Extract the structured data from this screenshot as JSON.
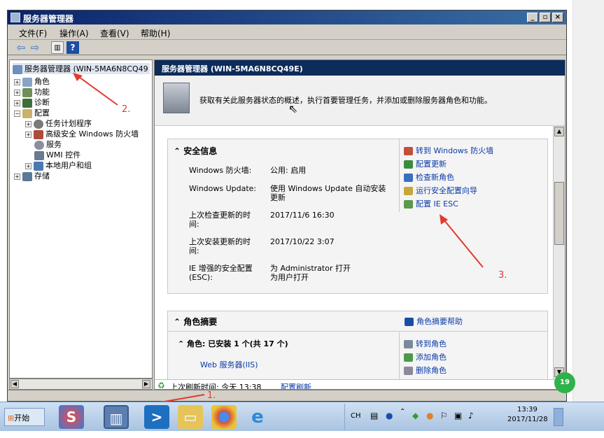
{
  "window": {
    "title": "服务器管理器",
    "min_label": "_",
    "max_label": "▫",
    "close_label": "×"
  },
  "menu": [
    "文件(F)",
    "操作(A)",
    "查看(V)",
    "帮助(H)"
  ],
  "tree": {
    "root": "服务器管理器 (WIN-5MA6N8CQ49",
    "items": [
      "角色",
      "功能",
      "诊断",
      "配置",
      "任务计划程序",
      "高级安全 Windows 防火墙",
      "服务",
      "WMI 控件",
      "本地用户和组",
      "存储"
    ]
  },
  "header": {
    "title": "服务器管理器 (WIN-5MA6N8CQ49E)"
  },
  "banner": {
    "text": "获取有关此服务器状态的概述，执行首要管理任务，并添加或删除服务器角色和功能。"
  },
  "security": {
    "heading": "安全信息",
    "rows": [
      {
        "label": "Windows 防火墙:",
        "value": "公用: 启用"
      },
      {
        "label": "Windows Update:",
        "value": "使用 Windows Update 自动安装更新"
      },
      {
        "label": "上次检查更新的时间:",
        "value": "2017/11/6 16:30"
      },
      {
        "label": "上次安装更新的时间:",
        "value": "2017/10/22 3:07"
      },
      {
        "label": "IE 增强的安全配置(ESC):",
        "value": "为 Administrator 打开\n为用户打开"
      }
    ],
    "links": [
      "转到 Windows 防火墙",
      "配置更新",
      "检查新角色",
      "运行安全配置向导",
      "配置 IE ESC"
    ]
  },
  "roles_summary": {
    "heading": "角色摘要",
    "help_link": "角色摘要帮助",
    "installed": "角色: 已安装 1 个(共 17 个)",
    "role_item": "Web 服务器(IIS)",
    "links": [
      "转到角色",
      "添加角色",
      "删除角色"
    ]
  },
  "status": {
    "refresh_label": "上次刷新时间: 今天 13:38",
    "refresh_link": "配置刷新"
  },
  "annotations": {
    "a1": "1.",
    "a2": "2.",
    "a3": "3."
  },
  "taskbar": {
    "start_label": "开始",
    "lang": "CH",
    "time": "13:39",
    "date": "2017/11/28",
    "badge": "19"
  },
  "colors": {
    "header": "#0c2c5a",
    "link": "#0b3aa8",
    "arrow": "#e03b2e"
  }
}
